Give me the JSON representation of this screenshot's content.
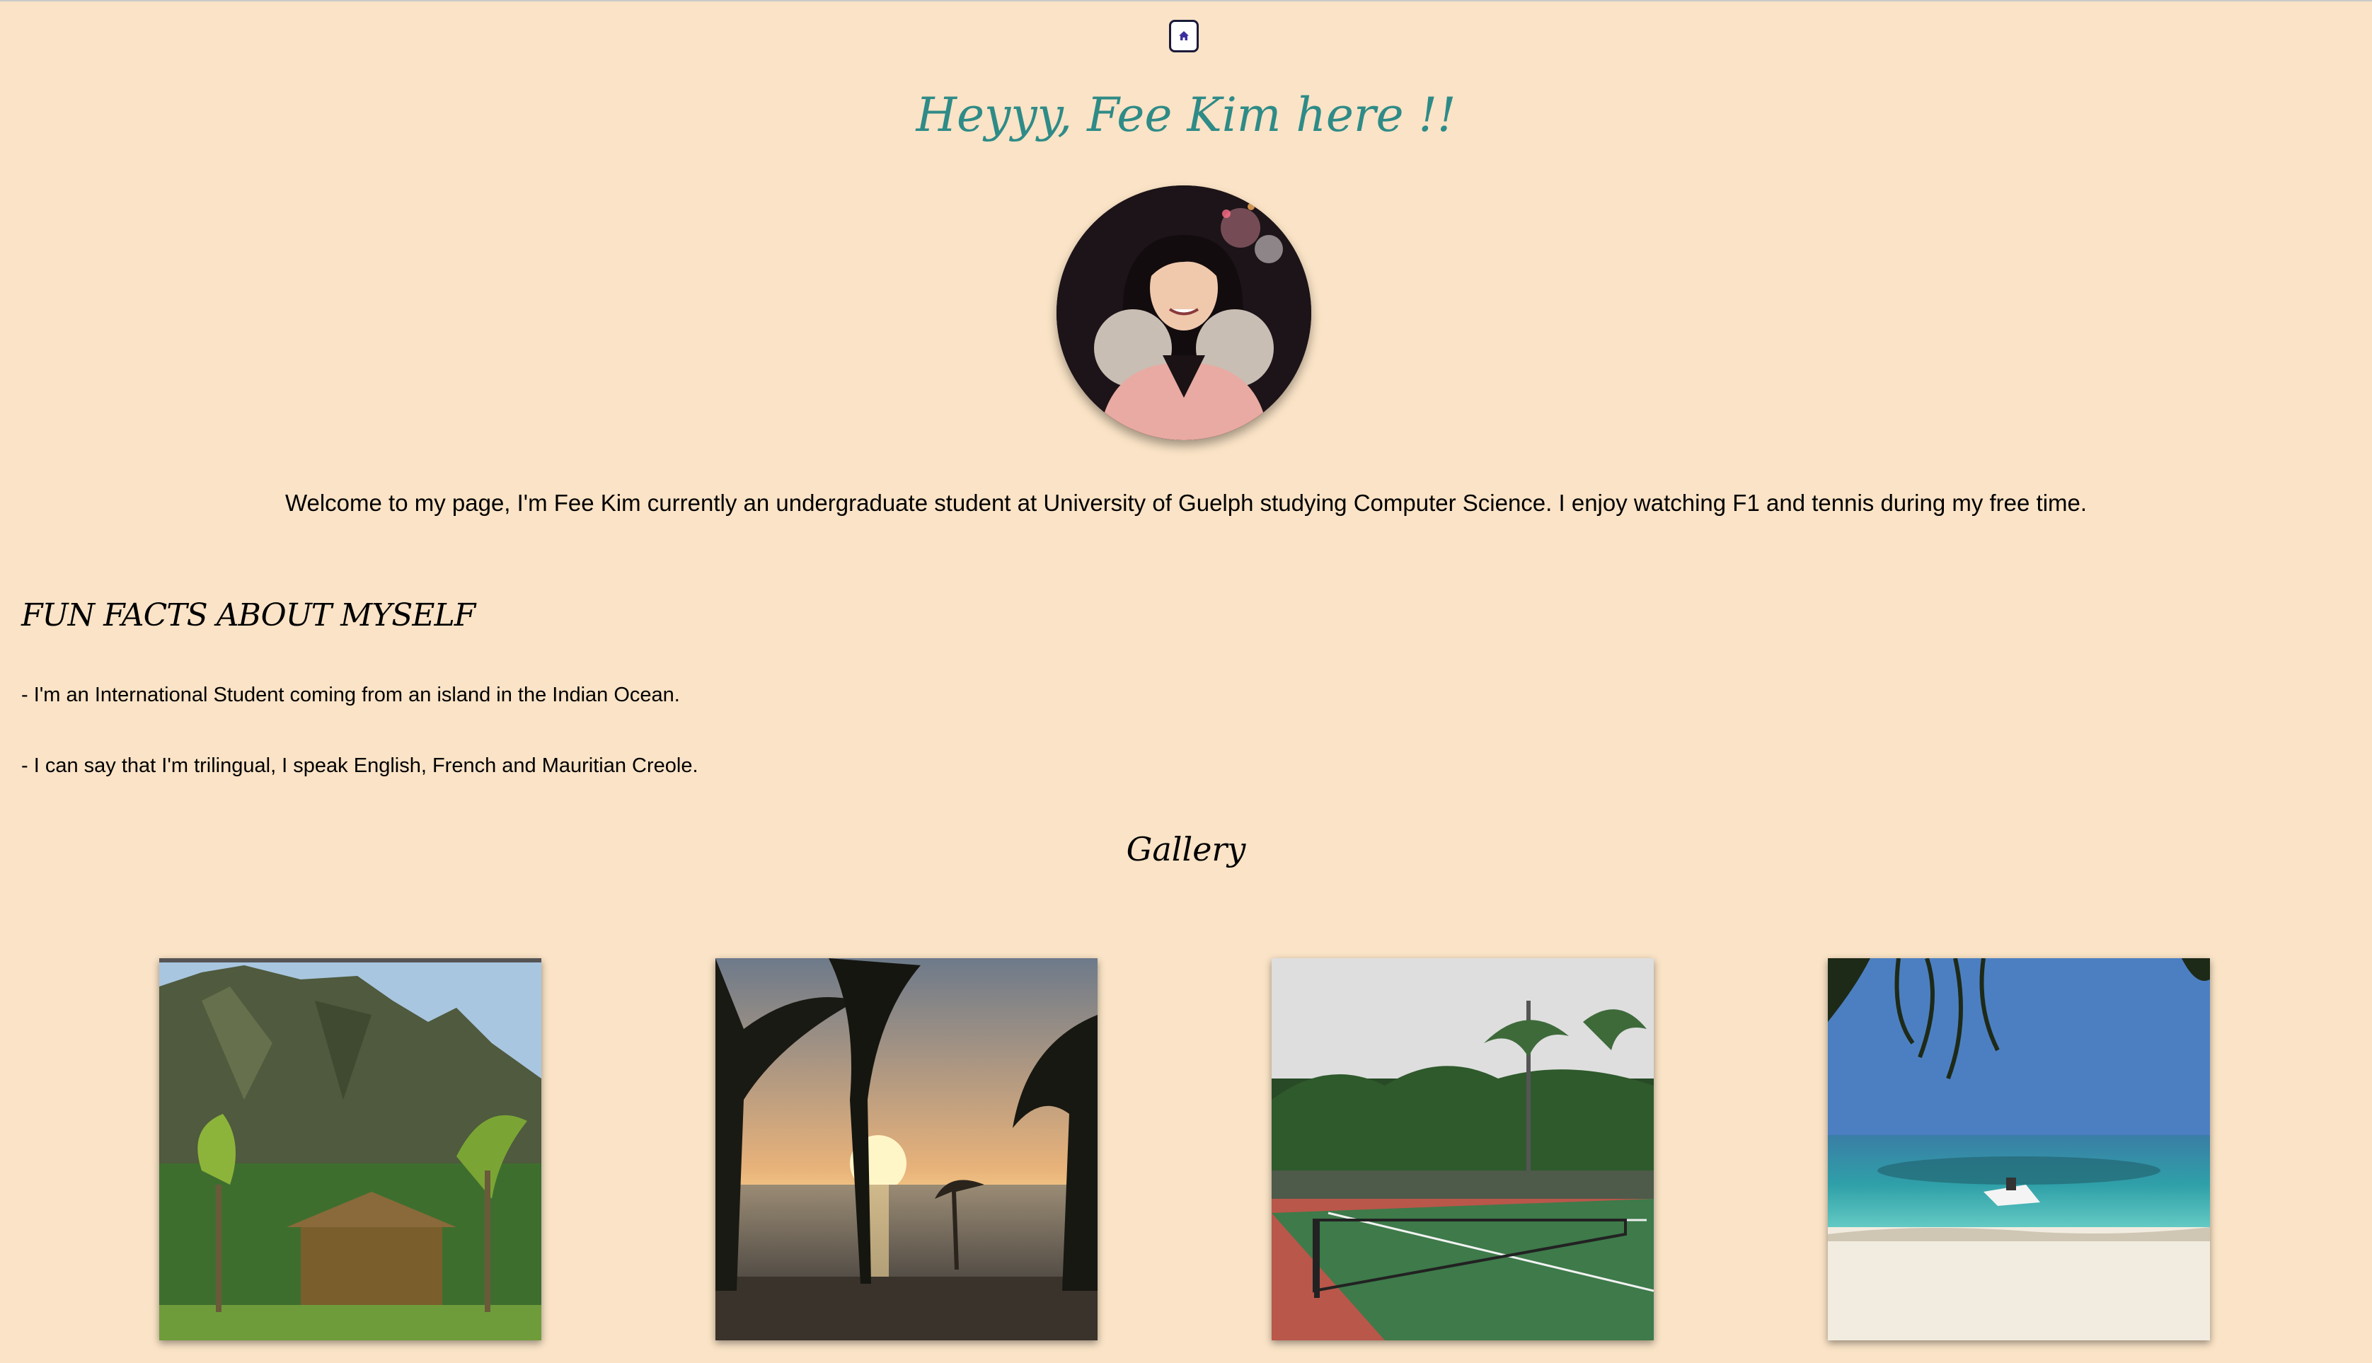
{
  "nav": {
    "home_icon": "home-icon"
  },
  "header": {
    "title": "Heyyy, Fee Kim here !!"
  },
  "profile": {
    "photo_description_icon": "profile-photo"
  },
  "intro": {
    "text": "Welcome to my page, I'm Fee Kim currently an undergraduate student at University of Guelph studying Computer Science. I enjoy watching F1 and tennis during my free time."
  },
  "fun_facts": {
    "heading": "FUN FACTS ABOUT MYSELF",
    "items": [
      "- I'm an International Student coming from an island in the Indian Ocean.",
      "- I can say that I'm trilingual, I speak English, French and Mauritian Creole."
    ]
  },
  "gallery": {
    "heading": "Gallery"
  },
  "colors": {
    "background": "#fae3c6",
    "title": "#2e8b87"
  }
}
